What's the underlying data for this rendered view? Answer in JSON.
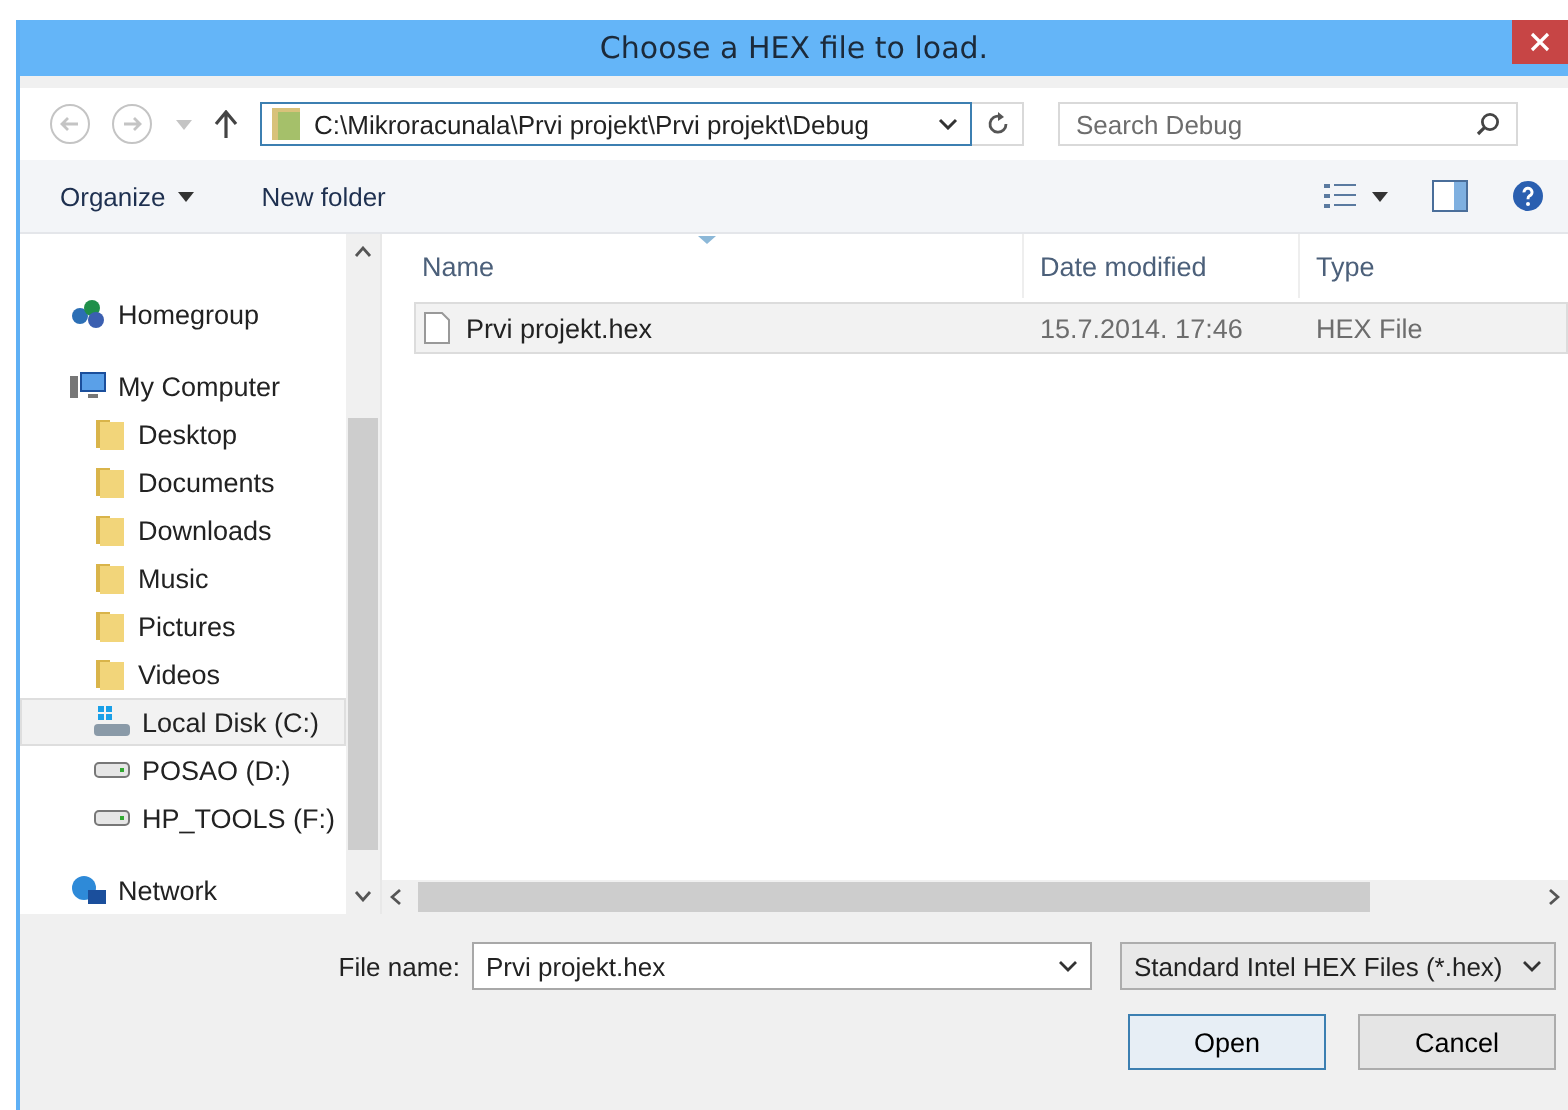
{
  "window": {
    "title": "Choose a HEX file to load."
  },
  "address": {
    "path": "C:\\Mikroracunala\\Prvi projekt\\Prvi projekt\\Debug"
  },
  "search": {
    "placeholder": "Search Debug"
  },
  "toolbar": {
    "organize": "Organize",
    "new_folder": "New folder"
  },
  "sidebar": {
    "items": [
      {
        "label": "Homegroup",
        "kind": "homegroup",
        "selected": false
      },
      {
        "label": "My Computer",
        "kind": "computer",
        "selected": false,
        "children": [
          {
            "label": "Desktop",
            "kind": "folder",
            "selected": false
          },
          {
            "label": "Documents",
            "kind": "folder",
            "selected": false
          },
          {
            "label": "Downloads",
            "kind": "folder",
            "selected": false
          },
          {
            "label": "Music",
            "kind": "folder",
            "selected": false
          },
          {
            "label": "Pictures",
            "kind": "folder",
            "selected": false
          },
          {
            "label": "Videos",
            "kind": "folder",
            "selected": false
          },
          {
            "label": "Local Disk (C:)",
            "kind": "sysdrive",
            "selected": true
          },
          {
            "label": "POSAO (D:)",
            "kind": "drive",
            "selected": false
          },
          {
            "label": "HP_TOOLS (F:)",
            "kind": "drive",
            "selected": false
          }
        ]
      },
      {
        "label": "Network",
        "kind": "network",
        "selected": false
      }
    ]
  },
  "table": {
    "columns": [
      "Name",
      "Date modified",
      "Type"
    ],
    "rows": [
      {
        "name": "Prvi projekt.hex",
        "date": "15.7.2014. 17:46",
        "type": "HEX File",
        "selected": true
      }
    ]
  },
  "file_name": {
    "label": "File name:",
    "value": "Prvi projekt.hex"
  },
  "file_type": {
    "value": "Standard Intel HEX Files (*.hex)"
  },
  "buttons": [
    {
      "label": "Open",
      "kind": "default"
    },
    {
      "label": "Cancel",
      "kind": "normal"
    }
  ]
}
